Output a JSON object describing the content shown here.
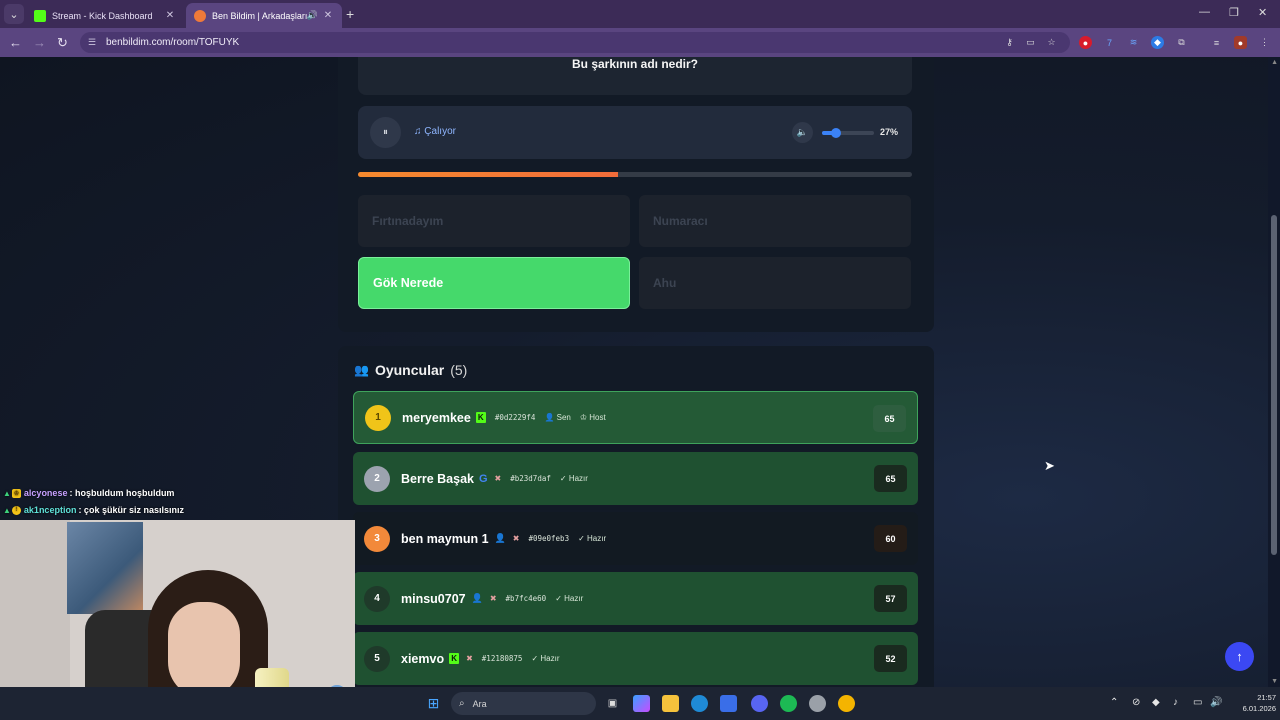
{
  "browser": {
    "tabs": [
      {
        "title": "Stream - Kick Dashboard",
        "favicon": "kick-icon"
      },
      {
        "title": "Ben Bildim | Arkadaşlarınla",
        "favicon": "benbildim-icon",
        "audio": true
      }
    ],
    "url": "benbildim.com/room/TOFUYK"
  },
  "quiz": {
    "question": "Bu şarkının adı nedir?",
    "player": {
      "status": "Çalıyor",
      "volume_pct": "27%",
      "volume_value": 0.27,
      "song_progress": 0.47
    },
    "answers": [
      {
        "label": "Fırtınadayım",
        "state": "disabled"
      },
      {
        "label": "Numaracı",
        "state": "disabled"
      },
      {
        "label": "Gök Nerede",
        "state": "correct"
      },
      {
        "label": "Ahu",
        "state": "disabled"
      }
    ]
  },
  "players": {
    "title": "Oyuncular",
    "count": "(5)",
    "list": [
      {
        "rank": "1",
        "name": "meryemkee",
        "badge": "kick",
        "id": "#0d2229f4",
        "tags": [
          "Sen",
          "Host"
        ],
        "score": "65",
        "rank_color": "#f0c419"
      },
      {
        "rank": "2",
        "name": "Berre Başak",
        "badge": "google",
        "id": "#b23d7daf",
        "tags": [
          "Hazır"
        ],
        "score": "65",
        "rank_color": "#9ca3af"
      },
      {
        "rank": "3",
        "name": "ben maymun 1",
        "badge": "user",
        "id": "#09e0feb3",
        "tags": [
          "Hazır"
        ],
        "score": "60",
        "rank_color": "#f2893a"
      },
      {
        "rank": "4",
        "name": "minsu0707",
        "badge": "user",
        "id": "#b7fc4e60",
        "tags": [
          "Hazır"
        ],
        "score": "57",
        "rank_color": "#2a3a2f"
      },
      {
        "rank": "5",
        "name": "xiemvo",
        "badge": "kick",
        "id": "#12180875",
        "tags": [
          "Hazır"
        ],
        "score": "52",
        "rank_color": "#2a3a2f"
      }
    ]
  },
  "chat": [
    {
      "user": "alcyonese",
      "message": ": hoşbuldum hoşbuldum",
      "user_color": "#c6a0ff"
    },
    {
      "user": "ak1nception",
      "message": ": çok şükür siz nasılsınız",
      "user_color": "#5fe0d8"
    }
  ],
  "taskbar": {
    "search_placeholder": "Ara",
    "time": "21:57",
    "date": "6.01.2026"
  }
}
